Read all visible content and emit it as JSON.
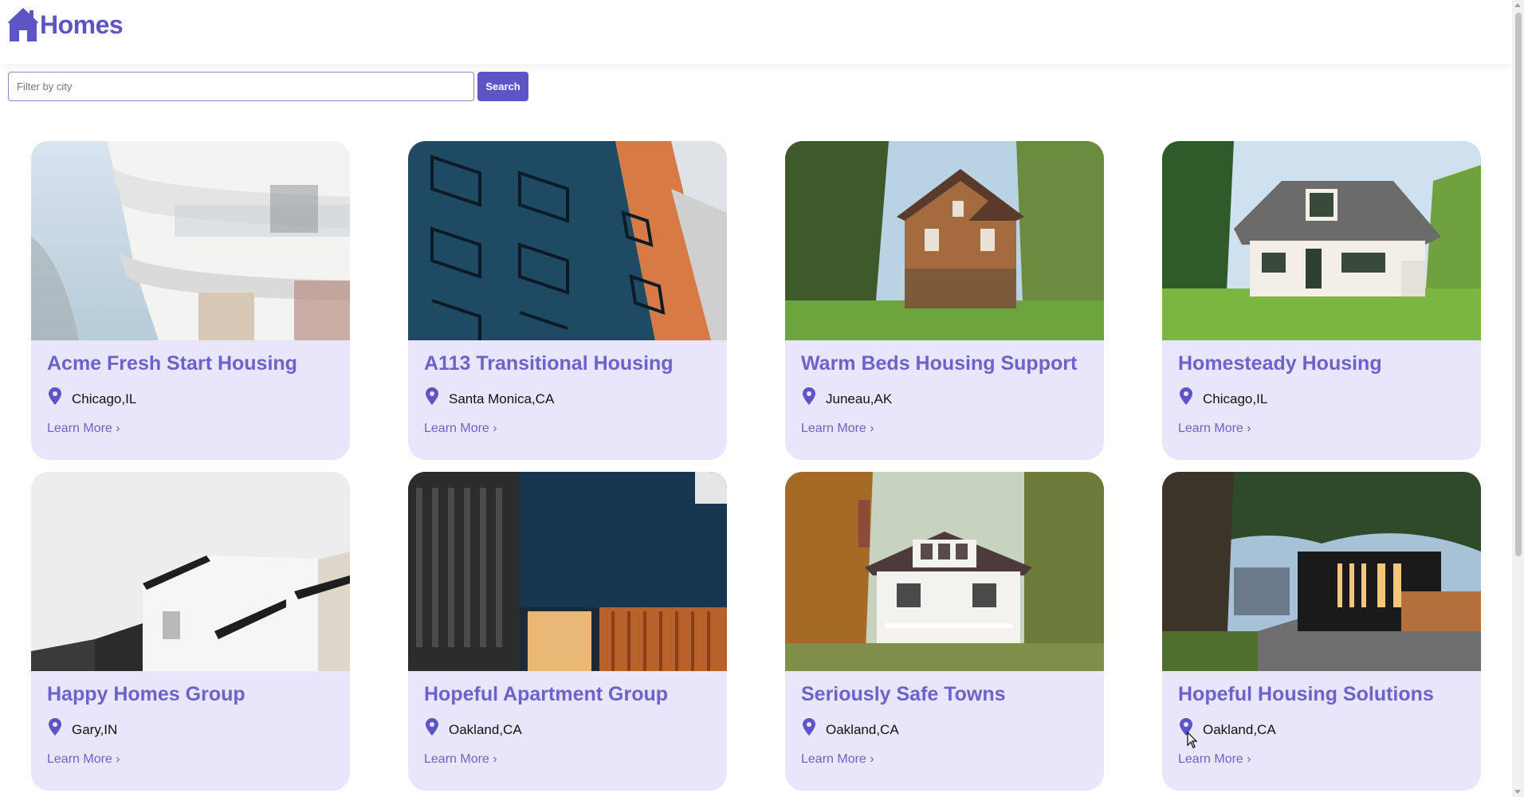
{
  "header": {
    "logo_text": "Homes",
    "logo_icon": "house-icon",
    "accent_color": "#5d54c6"
  },
  "search": {
    "placeholder": "Filter by city",
    "value": "",
    "button_label": "Search"
  },
  "listings": [
    {
      "title": "Acme Fresh Start Housing",
      "location": "Chicago,IL",
      "link": "Learn More ›",
      "image": "modern-white-balcony-building"
    },
    {
      "title": "A113 Transitional Housing",
      "location": "Santa Monica,CA",
      "link": "Learn More ›",
      "image": "blue-orange-apartment-balconies"
    },
    {
      "title": "Warm Beds Housing Support",
      "location": "Juneau,AK",
      "link": "Learn More ›",
      "image": "victorian-brick-house"
    },
    {
      "title": "Homesteady Housing",
      "location": "Chicago,IL",
      "link": "Learn More ›",
      "image": "white-cottage-with-lawn"
    },
    {
      "title": "Happy Homes Group",
      "location": "Gary,IN",
      "link": "Learn More ›",
      "image": "white-black-modern-house"
    },
    {
      "title": "Hopeful Apartment Group",
      "location": "Oakland,CA",
      "link": "Learn More ›",
      "image": "dark-modern-building-wood-slats"
    },
    {
      "title": "Seriously Safe Towns",
      "location": "Oakland,CA",
      "link": "Learn More ›",
      "image": "white-house-autumn-trees"
    },
    {
      "title": "Hopeful Housing Solutions",
      "location": "Oakland,CA",
      "link": "Learn More ›",
      "image": "modern-house-night-lit"
    }
  ],
  "colors": {
    "card_bg": "#e9e6fb",
    "title": "#6b63cc",
    "pin": "#5d54c6"
  }
}
